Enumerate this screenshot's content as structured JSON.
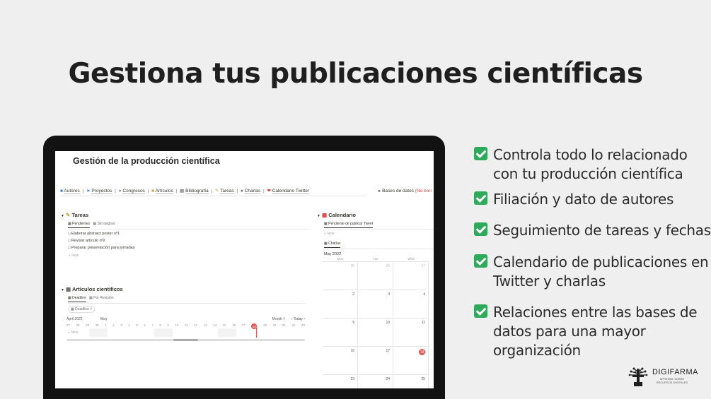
{
  "headline": "Gestiona tus publicaciones científicas",
  "app": {
    "doc_title": "Gestión de la producción científica",
    "nav": [
      "Autores",
      "Proyectos",
      "Congresos",
      "Artículos",
      "Bibliografía",
      "Tareas",
      "Charlas",
      "Calendario Twitter"
    ],
    "bases_label": "Bases de datos",
    "bases_note": "(No borr",
    "tareas": {
      "title": "Tareas",
      "tabs": [
        "Pendientes",
        "Sin asignar"
      ],
      "items": [
        "Elaborar abstract poster nº1",
        "Revisar artículo nº2",
        "Preparar presentación para jornadas"
      ],
      "new_label": "New"
    },
    "articulos": {
      "title": "Artículos científicos",
      "tabs": [
        "Deadline",
        "Por Revisión"
      ],
      "filter": "Deadline",
      "month_left": "April 2022",
      "month_right": "May",
      "view_label": "Month",
      "today_label": "Today",
      "days": [
        "27",
        "28",
        "29",
        "30",
        "1",
        "2",
        "3",
        "4",
        "5",
        "6",
        "7",
        "8",
        "9",
        "10",
        "11",
        "12",
        "13",
        "14",
        "15",
        "16",
        "17",
        "18",
        "19",
        "20",
        "21",
        "22",
        "23"
      ],
      "today_day": "18",
      "new_label": "New"
    },
    "calendario": {
      "title": "Calendario",
      "tab": "Pendiente de publicar Tweet",
      "new_label": "New",
      "tab2": "Charlas",
      "month": "May 2022",
      "weekdays": [
        "Mon",
        "Tue",
        "Wed"
      ],
      "rows": [
        [
          "25",
          "26",
          "27"
        ],
        [
          "2",
          "3",
          "4"
        ],
        [
          "9",
          "10",
          "11"
        ],
        [
          "16",
          "17",
          "18"
        ],
        [
          "23",
          "24",
          "25"
        ]
      ],
      "today_day": "18"
    }
  },
  "bullets": [
    "Controla todo lo relacionado con tu producción científica",
    "Filiación y dato de autores",
    "Seguimiento de tareas y fechas",
    "Calendario de publicaciones en Twitter y charlas",
    "Relaciones entre las bases de datos para una mayor organización"
  ],
  "logo": {
    "name": "DIGIFARMA",
    "tagline": "APRENDE SOBRE RECURSOS DIGITALES"
  },
  "colors": {
    "check": "#2eaa5b",
    "today": "#e55353",
    "laptop": "#121212"
  }
}
